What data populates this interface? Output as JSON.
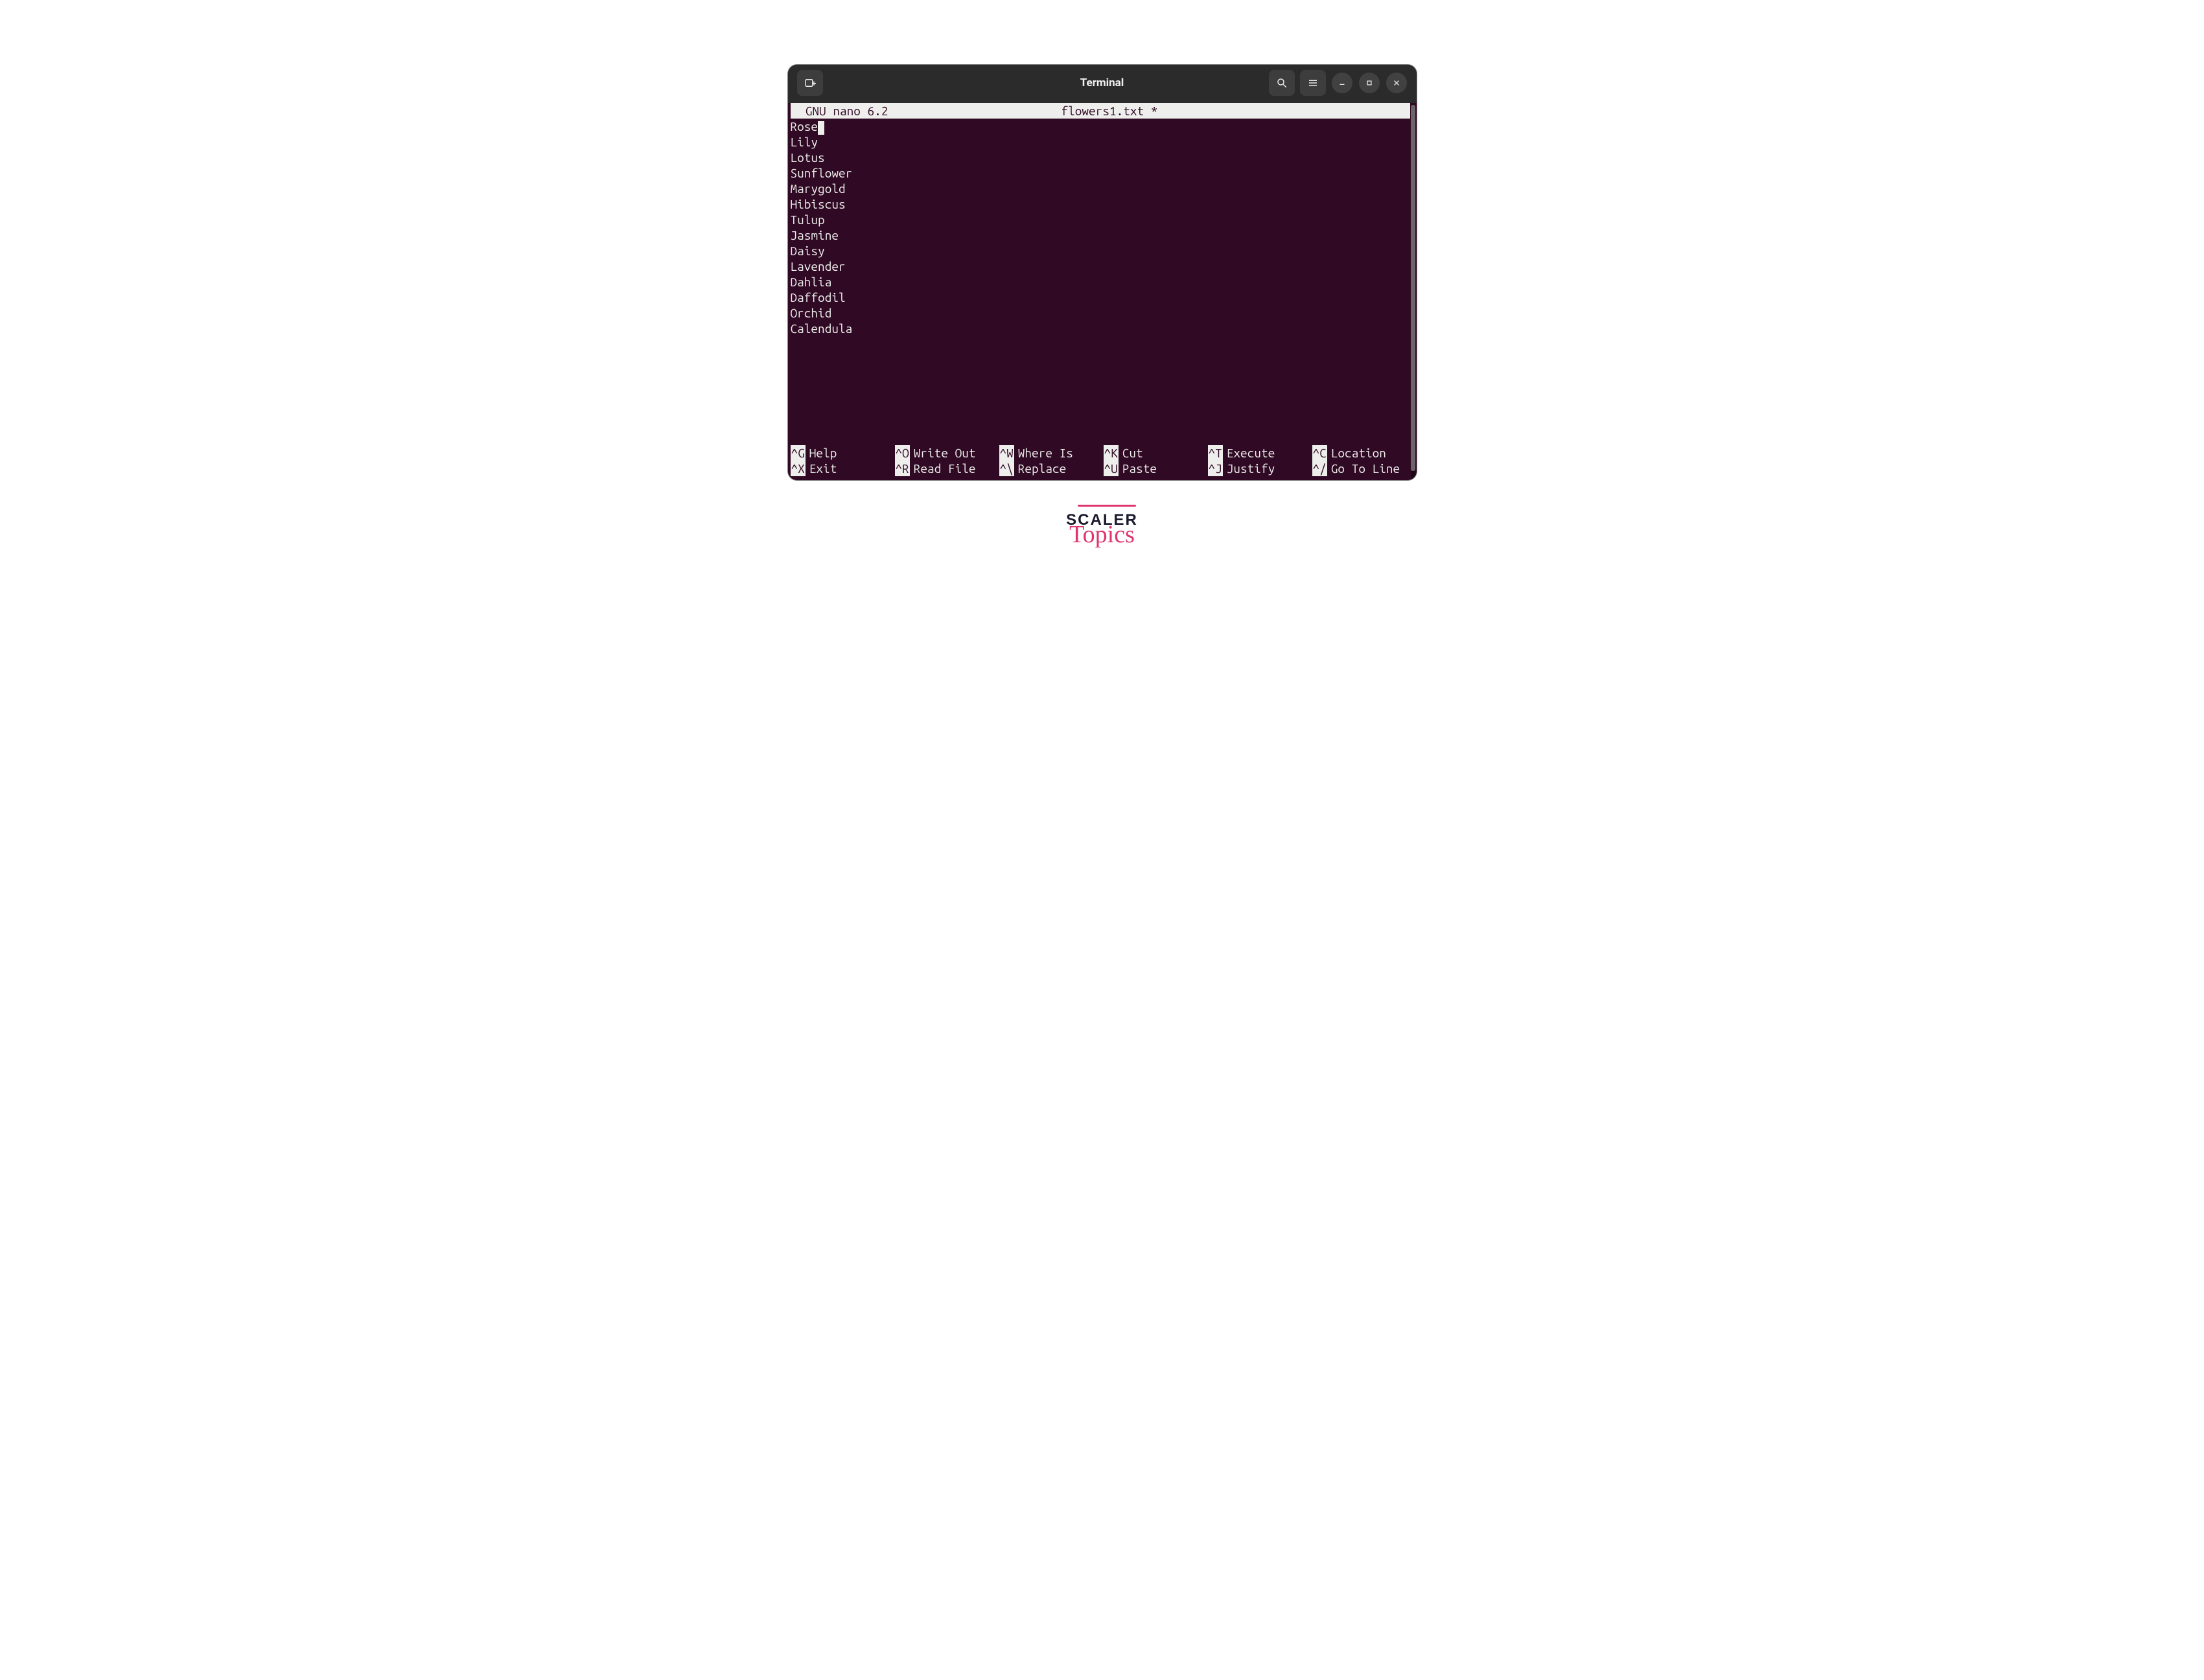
{
  "window": {
    "title": "Terminal"
  },
  "nano": {
    "app": "  GNU nano 6.2",
    "filename": "flowers1.txt *",
    "lines": [
      "Rose",
      "Lily",
      "Lotus",
      "Sunflower",
      "Marygold",
      "Hibiscus",
      "Tulup",
      "Jasmine",
      "Daisy",
      "Lavender",
      "Dahlia",
      "Daffodil",
      "Orchid",
      "Calendula"
    ],
    "cursor_line": 0
  },
  "shortcuts": {
    "row1": [
      {
        "key": "^G",
        "label": "Help"
      },
      {
        "key": "^O",
        "label": "Write Out"
      },
      {
        "key": "^W",
        "label": "Where Is"
      },
      {
        "key": "^K",
        "label": "Cut"
      },
      {
        "key": "^T",
        "label": "Execute"
      },
      {
        "key": "^C",
        "label": "Location"
      }
    ],
    "row2": [
      {
        "key": "^X",
        "label": "Exit"
      },
      {
        "key": "^R",
        "label": "Read File"
      },
      {
        "key": "^\\",
        "label": "Replace"
      },
      {
        "key": "^U",
        "label": "Paste"
      },
      {
        "key": "^J",
        "label": "Justify"
      },
      {
        "key": "^/",
        "label": "Go To Line"
      }
    ]
  },
  "branding": {
    "line1": "SCALER",
    "line2": "Topics"
  }
}
